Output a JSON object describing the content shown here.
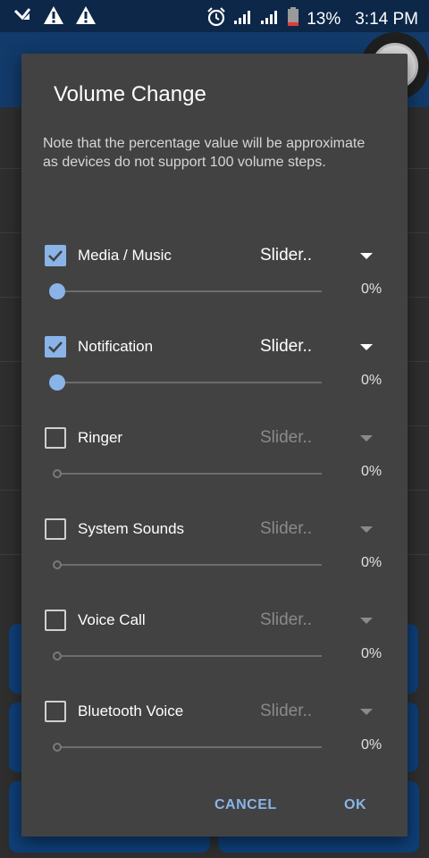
{
  "status_bar": {
    "battery": "13%",
    "time": "3:14 PM"
  },
  "dialog": {
    "title": "Volume Change",
    "note": "Note that the percentage value will be approximate as devices do not support 100 volume steps.",
    "items": [
      {
        "label": "Media / Music",
        "checked": true,
        "mode": "Slider..",
        "percent": "0%"
      },
      {
        "label": "Notification",
        "checked": true,
        "mode": "Slider..",
        "percent": "0%"
      },
      {
        "label": "Ringer",
        "checked": false,
        "mode": "Slider..",
        "percent": "0%"
      },
      {
        "label": "System Sounds",
        "checked": false,
        "mode": "Slider..",
        "percent": "0%"
      },
      {
        "label": "Voice Call",
        "checked": false,
        "mode": "Slider..",
        "percent": "0%"
      },
      {
        "label": "Bluetooth Voice",
        "checked": false,
        "mode": "Slider..",
        "percent": "0%"
      }
    ],
    "cancel_label": "CANCEL",
    "ok_label": "OK"
  },
  "colors": {
    "accent": "#8ab4e8",
    "dialog_bg": "#424242",
    "status_bar": "#0c2748"
  }
}
